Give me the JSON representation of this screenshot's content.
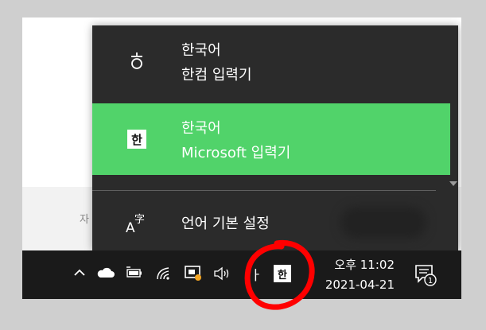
{
  "background": {
    "side_char": "자"
  },
  "ime_menu": {
    "items": [
      {
        "icon": "hangul-ieung-icon",
        "glyph": "ㅎ",
        "language": "한국어",
        "ime": "한컴 입력기",
        "selected": false
      },
      {
        "icon": "han-box-icon",
        "glyph": "한",
        "language": "한국어",
        "ime": "Microsoft 입력기",
        "selected": true
      }
    ],
    "settings": {
      "icon": "language-settings-icon",
      "label": "언어 기본 설정"
    }
  },
  "taskbar": {
    "tray_icons": [
      "chevron-up-icon",
      "onedrive-cloud-icon",
      "battery-icon",
      "wifi-icon",
      "meet-now-icon",
      "volume-icon"
    ],
    "ime_mode_glyph": "ㅏ",
    "language_indicator": "한",
    "clock": {
      "time": "오후 11:02",
      "date": "2021-04-21"
    },
    "notification_count": "1"
  },
  "colors": {
    "selected": "#51d36a",
    "popup_bg": "#2b2b2b",
    "taskbar_bg": "#1a1a1a",
    "annotation": "#ff0000"
  }
}
